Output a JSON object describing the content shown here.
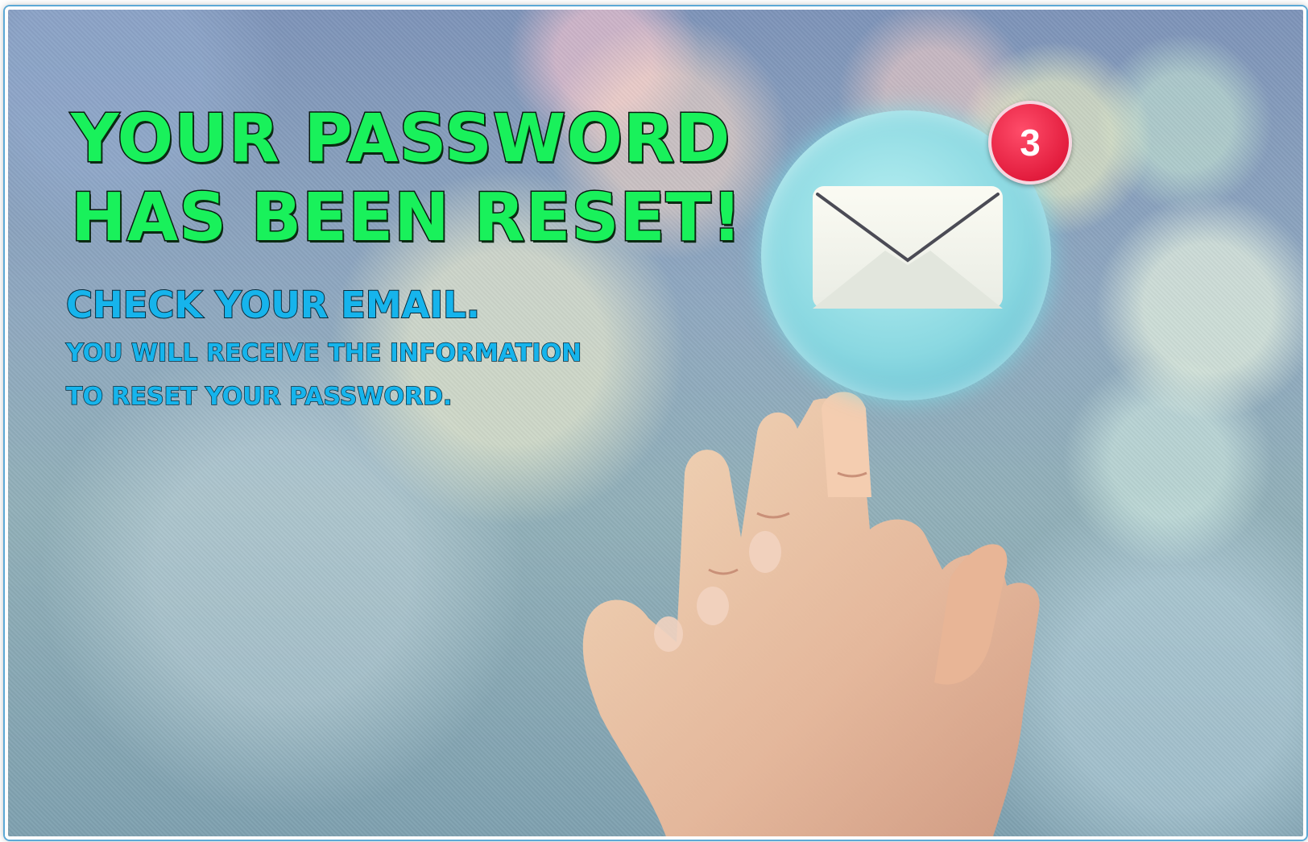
{
  "headline": {
    "line1": "YOUR PASSWORD",
    "line2": "HAS BEEN RESET!"
  },
  "subhead": "CHECK YOUR EMAIL.",
  "info": {
    "line1": "YOU WILL RECEIVE THE INFORMATION",
    "line2": "TO RESET YOUR PASSWORD."
  },
  "notification": {
    "count": "3",
    "icon": "envelope-icon"
  },
  "colors": {
    "headline": "#19f15b",
    "subtext": "#16b4ec",
    "badge": "#e31d3e"
  }
}
